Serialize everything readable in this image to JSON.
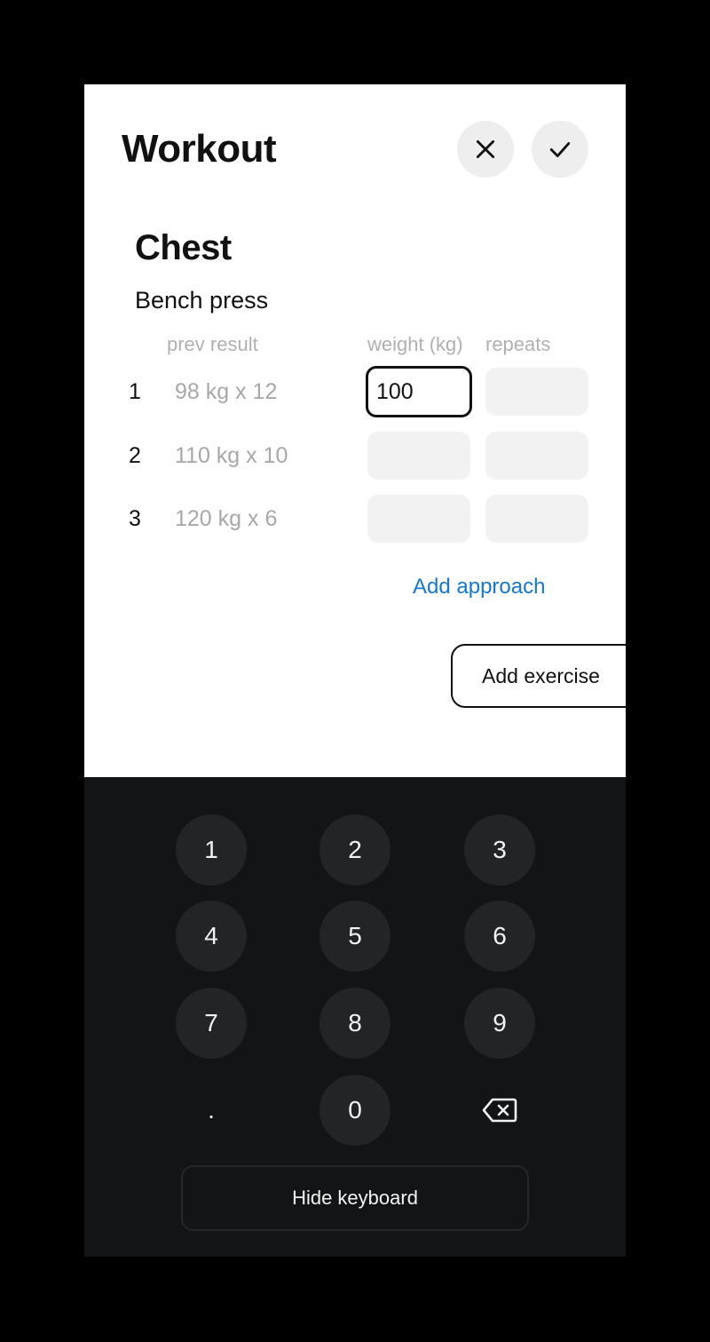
{
  "header": {
    "title": "Workout",
    "close_icon": "close-icon",
    "confirm_icon": "checkmark-icon"
  },
  "section": {
    "title": "Chest",
    "exercise": "Bench press",
    "columns": {
      "prev": "prev result",
      "weight": "weight (kg)",
      "repeats": "repeats"
    },
    "rows": [
      {
        "num": "1",
        "prev": "98 kg x 12",
        "weight": "100",
        "repeats": ""
      },
      {
        "num": "2",
        "prev": "110 kg x 10",
        "weight": "",
        "repeats": ""
      },
      {
        "num": "3",
        "prev": "120 kg x 6",
        "weight": "",
        "repeats": ""
      }
    ],
    "add_approach": "Add approach",
    "add_exercise": "Add exercise"
  },
  "keyboard": {
    "keys": [
      "1",
      "2",
      "3",
      "4",
      "5",
      "6",
      "7",
      "8",
      "9",
      ".",
      "0"
    ],
    "backspace_icon": "backspace-icon",
    "hide_label": "Hide keyboard"
  },
  "colors": {
    "accent_link": "#1478d4",
    "keyboard_bg": "#131416",
    "key_bg": "#232427"
  }
}
